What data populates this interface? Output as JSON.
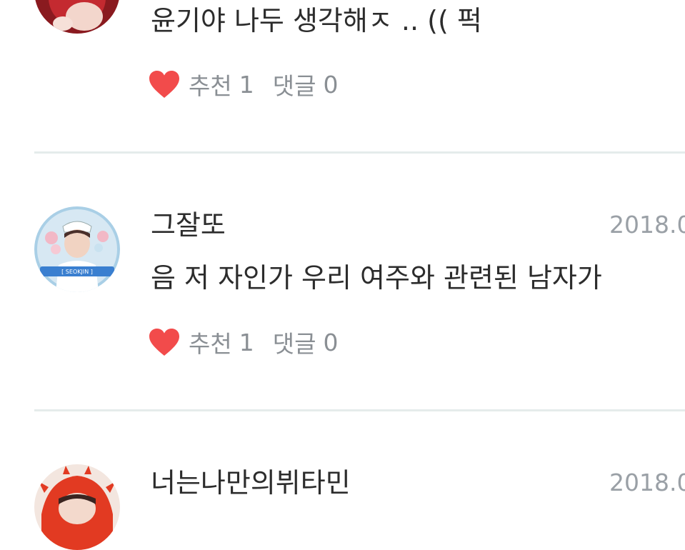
{
  "colors": {
    "heart": "#f24b4b",
    "text_primary": "#2c2c2c",
    "text_secondary": "#8a8f94",
    "date": "#9aa0a6",
    "divider": "#e5eceb"
  },
  "comments": [
    {
      "author": "",
      "date": "",
      "text": "윤기야 나두 생각해ㅈ .. (( 퍽",
      "like_label": "추천",
      "like_count": "1",
      "reply_label": "댓글",
      "reply_count": "0",
      "avatar_icon": "profile-photo"
    },
    {
      "author": "그잘또",
      "date": "2018.0",
      "text": "음 저 자인가 우리 여주와 관련된 남자가",
      "like_label": "추천",
      "like_count": "1",
      "reply_label": "댓글",
      "reply_count": "0",
      "avatar_icon": "profile-photo",
      "avatar_badge": "[ SEOKJIN ]"
    },
    {
      "author": "너는나만의뷔타민",
      "date": "2018.0",
      "text": "",
      "avatar_icon": "profile-photo"
    }
  ]
}
